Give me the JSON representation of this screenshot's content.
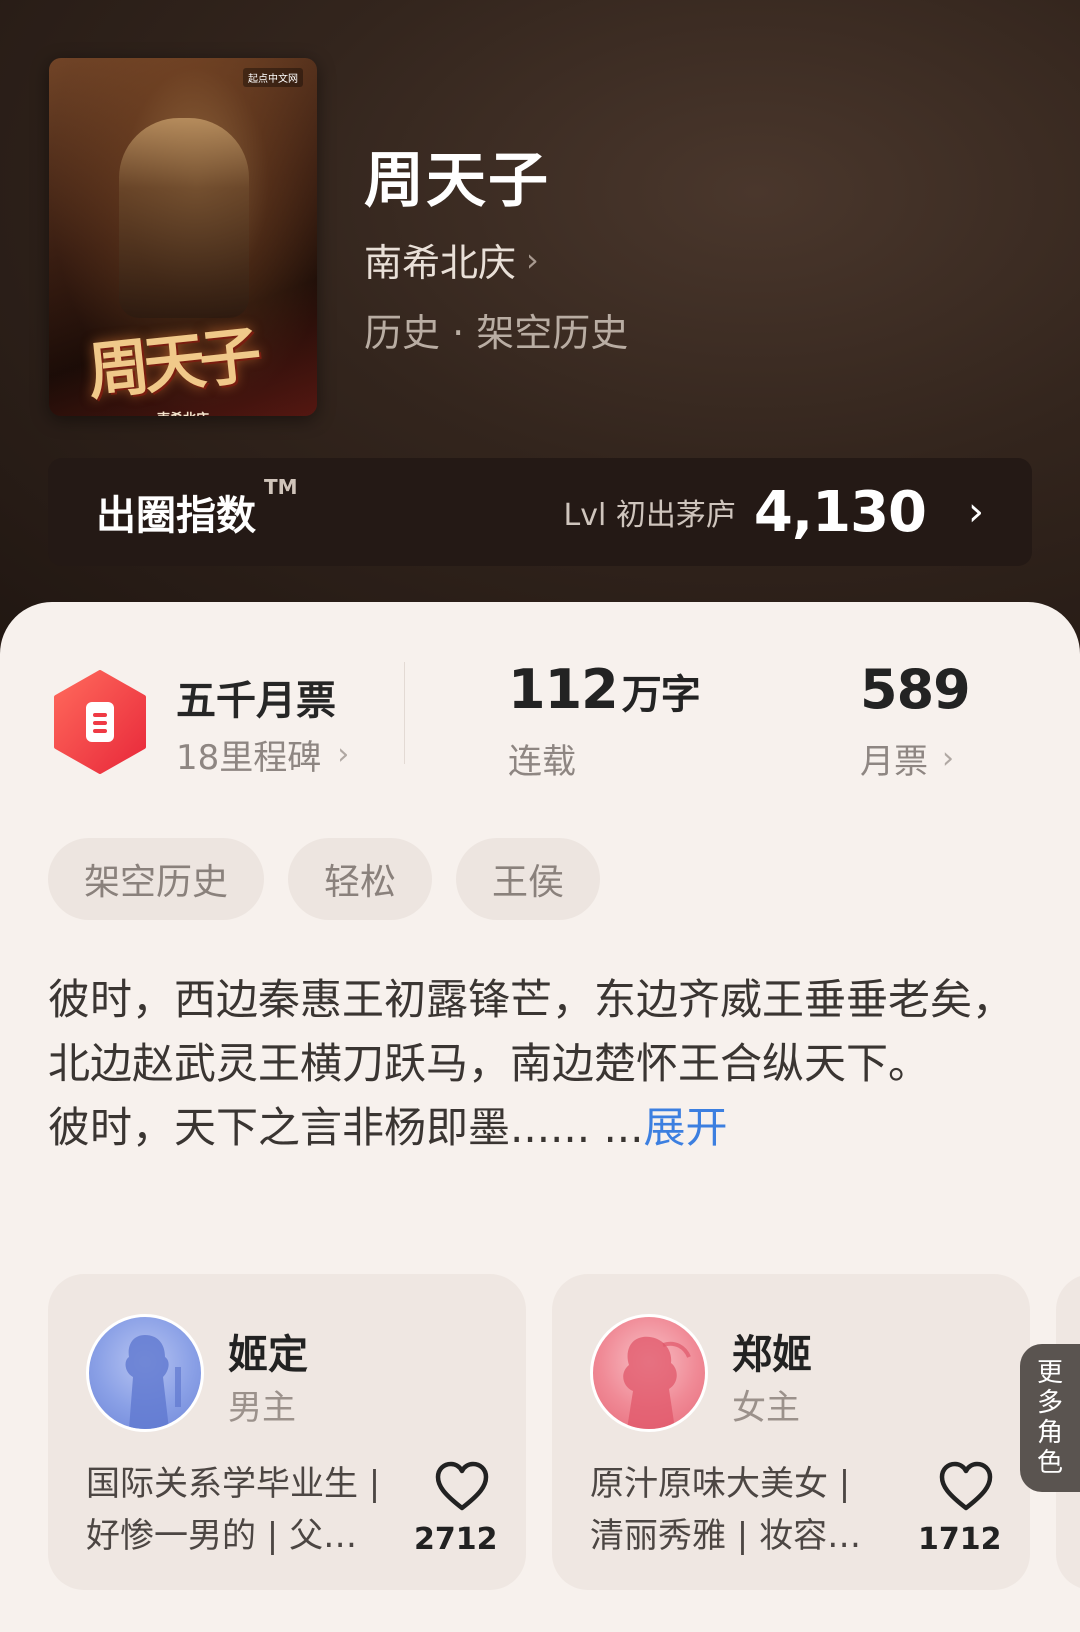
{
  "book": {
    "title": "周天子",
    "author": "南希北庆",
    "genre": "历史 · 架空历史",
    "cover": {
      "title_art": "周天子",
      "author": "南希北庆",
      "publisher": "起点中文网"
    }
  },
  "index_bar": {
    "label": "出圈指数",
    "tm": "TM",
    "level": "Lvl 初出茅庐",
    "score": "4,130"
  },
  "stats": {
    "ticket": {
      "title": "五千月票",
      "subtitle": "18里程碑"
    },
    "words": {
      "value": "112",
      "unit": "万字",
      "label": "连载"
    },
    "votes": {
      "value": "589",
      "label": "月票"
    }
  },
  "tags": [
    "架空历史",
    "轻松",
    "王侯"
  ],
  "synopsis": {
    "paragraph1": "彼时，西边秦惠王初露锋芒，东边齐威王垂垂老矣，北边赵武灵王横刀跃马，南边楚怀王合纵天下。",
    "paragraph2": "彼时，天下之言非杨即墨...... ...",
    "expand": "展开"
  },
  "characters": [
    {
      "name": "姬定",
      "role": "男主",
      "desc_line1": "国际关系学毕业生 |",
      "desc_line2": "好惨一男的 | 父…",
      "likes": "2712",
      "color": "#8aa0e6"
    },
    {
      "name": "郑姬",
      "role": "女主",
      "desc_line1": "原汁原味大美女 |",
      "desc_line2": "清丽秀雅 | 妆容…",
      "likes": "1712",
      "color": "#f08a96"
    }
  ],
  "more_roles": "更多角色",
  "colors": {
    "accent_red": "#f04a4a",
    "link_blue": "#3c7fe0",
    "hero_bg": "#2a1d17"
  }
}
